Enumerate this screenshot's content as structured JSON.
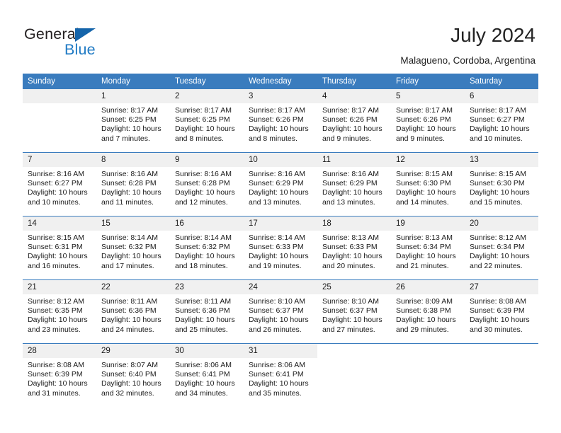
{
  "logo": {
    "word_top": "General",
    "word_bottom": "Blue",
    "triangle_color": "#1464aa",
    "blue_color": "#1f7ac4"
  },
  "header": {
    "title": "July 2024",
    "subtitle": "Malagueno, Cordoba, Argentina",
    "accent_color": "#3a7cbe",
    "daynum_band_color": "#f0f0f0"
  },
  "weekday_headers": [
    "Sunday",
    "Monday",
    "Tuesday",
    "Wednesday",
    "Thursday",
    "Friday",
    "Saturday"
  ],
  "calendar": {
    "weeks": [
      [
        {
          "day": "",
          "blank": true
        },
        {
          "day": "1",
          "sunrise": "Sunrise: 8:17 AM",
          "sunset": "Sunset: 6:25 PM",
          "daylight1": "Daylight: 10 hours",
          "daylight2": "and 7 minutes."
        },
        {
          "day": "2",
          "sunrise": "Sunrise: 8:17 AM",
          "sunset": "Sunset: 6:25 PM",
          "daylight1": "Daylight: 10 hours",
          "daylight2": "and 8 minutes."
        },
        {
          "day": "3",
          "sunrise": "Sunrise: 8:17 AM",
          "sunset": "Sunset: 6:26 PM",
          "daylight1": "Daylight: 10 hours",
          "daylight2": "and 8 minutes."
        },
        {
          "day": "4",
          "sunrise": "Sunrise: 8:17 AM",
          "sunset": "Sunset: 6:26 PM",
          "daylight1": "Daylight: 10 hours",
          "daylight2": "and 9 minutes."
        },
        {
          "day": "5",
          "sunrise": "Sunrise: 8:17 AM",
          "sunset": "Sunset: 6:26 PM",
          "daylight1": "Daylight: 10 hours",
          "daylight2": "and 9 minutes."
        },
        {
          "day": "6",
          "sunrise": "Sunrise: 8:17 AM",
          "sunset": "Sunset: 6:27 PM",
          "daylight1": "Daylight: 10 hours",
          "daylight2": "and 10 minutes."
        }
      ],
      [
        {
          "day": "7",
          "sunrise": "Sunrise: 8:16 AM",
          "sunset": "Sunset: 6:27 PM",
          "daylight1": "Daylight: 10 hours",
          "daylight2": "and 10 minutes."
        },
        {
          "day": "8",
          "sunrise": "Sunrise: 8:16 AM",
          "sunset": "Sunset: 6:28 PM",
          "daylight1": "Daylight: 10 hours",
          "daylight2": "and 11 minutes."
        },
        {
          "day": "9",
          "sunrise": "Sunrise: 8:16 AM",
          "sunset": "Sunset: 6:28 PM",
          "daylight1": "Daylight: 10 hours",
          "daylight2": "and 12 minutes."
        },
        {
          "day": "10",
          "sunrise": "Sunrise: 8:16 AM",
          "sunset": "Sunset: 6:29 PM",
          "daylight1": "Daylight: 10 hours",
          "daylight2": "and 13 minutes."
        },
        {
          "day": "11",
          "sunrise": "Sunrise: 8:16 AM",
          "sunset": "Sunset: 6:29 PM",
          "daylight1": "Daylight: 10 hours",
          "daylight2": "and 13 minutes."
        },
        {
          "day": "12",
          "sunrise": "Sunrise: 8:15 AM",
          "sunset": "Sunset: 6:30 PM",
          "daylight1": "Daylight: 10 hours",
          "daylight2": "and 14 minutes."
        },
        {
          "day": "13",
          "sunrise": "Sunrise: 8:15 AM",
          "sunset": "Sunset: 6:30 PM",
          "daylight1": "Daylight: 10 hours",
          "daylight2": "and 15 minutes."
        }
      ],
      [
        {
          "day": "14",
          "sunrise": "Sunrise: 8:15 AM",
          "sunset": "Sunset: 6:31 PM",
          "daylight1": "Daylight: 10 hours",
          "daylight2": "and 16 minutes."
        },
        {
          "day": "15",
          "sunrise": "Sunrise: 8:14 AM",
          "sunset": "Sunset: 6:32 PM",
          "daylight1": "Daylight: 10 hours",
          "daylight2": "and 17 minutes."
        },
        {
          "day": "16",
          "sunrise": "Sunrise: 8:14 AM",
          "sunset": "Sunset: 6:32 PM",
          "daylight1": "Daylight: 10 hours",
          "daylight2": "and 18 minutes."
        },
        {
          "day": "17",
          "sunrise": "Sunrise: 8:14 AM",
          "sunset": "Sunset: 6:33 PM",
          "daylight1": "Daylight: 10 hours",
          "daylight2": "and 19 minutes."
        },
        {
          "day": "18",
          "sunrise": "Sunrise: 8:13 AM",
          "sunset": "Sunset: 6:33 PM",
          "daylight1": "Daylight: 10 hours",
          "daylight2": "and 20 minutes."
        },
        {
          "day": "19",
          "sunrise": "Sunrise: 8:13 AM",
          "sunset": "Sunset: 6:34 PM",
          "daylight1": "Daylight: 10 hours",
          "daylight2": "and 21 minutes."
        },
        {
          "day": "20",
          "sunrise": "Sunrise: 8:12 AM",
          "sunset": "Sunset: 6:34 PM",
          "daylight1": "Daylight: 10 hours",
          "daylight2": "and 22 minutes."
        }
      ],
      [
        {
          "day": "21",
          "sunrise": "Sunrise: 8:12 AM",
          "sunset": "Sunset: 6:35 PM",
          "daylight1": "Daylight: 10 hours",
          "daylight2": "and 23 minutes."
        },
        {
          "day": "22",
          "sunrise": "Sunrise: 8:11 AM",
          "sunset": "Sunset: 6:36 PM",
          "daylight1": "Daylight: 10 hours",
          "daylight2": "and 24 minutes."
        },
        {
          "day": "23",
          "sunrise": "Sunrise: 8:11 AM",
          "sunset": "Sunset: 6:36 PM",
          "daylight1": "Daylight: 10 hours",
          "daylight2": "and 25 minutes."
        },
        {
          "day": "24",
          "sunrise": "Sunrise: 8:10 AM",
          "sunset": "Sunset: 6:37 PM",
          "daylight1": "Daylight: 10 hours",
          "daylight2": "and 26 minutes."
        },
        {
          "day": "25",
          "sunrise": "Sunrise: 8:10 AM",
          "sunset": "Sunset: 6:37 PM",
          "daylight1": "Daylight: 10 hours",
          "daylight2": "and 27 minutes."
        },
        {
          "day": "26",
          "sunrise": "Sunrise: 8:09 AM",
          "sunset": "Sunset: 6:38 PM",
          "daylight1": "Daylight: 10 hours",
          "daylight2": "and 29 minutes."
        },
        {
          "day": "27",
          "sunrise": "Sunrise: 8:08 AM",
          "sunset": "Sunset: 6:39 PM",
          "daylight1": "Daylight: 10 hours",
          "daylight2": "and 30 minutes."
        }
      ],
      [
        {
          "day": "28",
          "sunrise": "Sunrise: 8:08 AM",
          "sunset": "Sunset: 6:39 PM",
          "daylight1": "Daylight: 10 hours",
          "daylight2": "and 31 minutes."
        },
        {
          "day": "29",
          "sunrise": "Sunrise: 8:07 AM",
          "sunset": "Sunset: 6:40 PM",
          "daylight1": "Daylight: 10 hours",
          "daylight2": "and 32 minutes."
        },
        {
          "day": "30",
          "sunrise": "Sunrise: 8:06 AM",
          "sunset": "Sunset: 6:41 PM",
          "daylight1": "Daylight: 10 hours",
          "daylight2": "and 34 minutes."
        },
        {
          "day": "31",
          "sunrise": "Sunrise: 8:06 AM",
          "sunset": "Sunset: 6:41 PM",
          "daylight1": "Daylight: 10 hours",
          "daylight2": "and 35 minutes."
        },
        {
          "day": "",
          "void": true
        },
        {
          "day": "",
          "void": true
        },
        {
          "day": "",
          "void": true
        }
      ]
    ]
  }
}
